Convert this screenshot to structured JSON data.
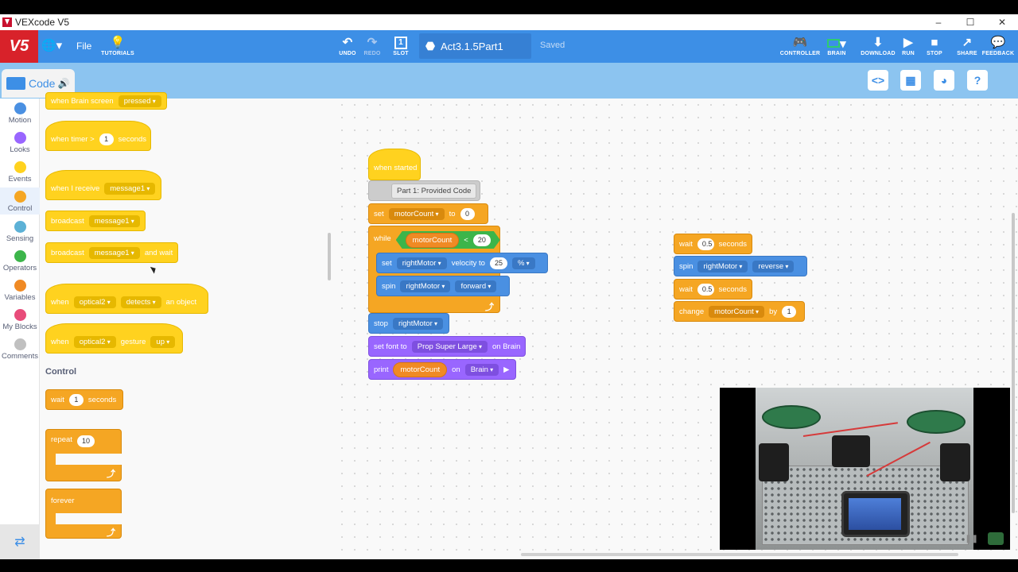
{
  "window": {
    "title": "VEXcode V5",
    "controls": [
      "–",
      "☐",
      "✕"
    ]
  },
  "toolbar": {
    "logo": "V5",
    "file_label": "File",
    "tutorials_label": "TUTORIALS",
    "undo_label": "UNDO",
    "redo_label": "REDO",
    "slot_label": "SLOT",
    "slot_value": "1",
    "project_name": "Act3.1.5Part1",
    "save_status": "Saved",
    "controller_label": "CONTROLLER",
    "brain_label": "BRAIN",
    "download_label": "DOWNLOAD",
    "run_label": "RUN",
    "stop_label": "STOP",
    "share_label": "SHARE",
    "feedback_label": "FEEDBACK"
  },
  "code_tab": {
    "label": "Code"
  },
  "categories": [
    {
      "label": "Motion",
      "color": "#4a90e2"
    },
    {
      "label": "Looks",
      "color": "#9966ff"
    },
    {
      "label": "Events",
      "color": "#ffd21f"
    },
    {
      "label": "Control",
      "color": "#f5a623"
    },
    {
      "label": "Sensing",
      "color": "#5cb1d6"
    },
    {
      "label": "Operators",
      "color": "#3cb54a"
    },
    {
      "label": "Variables",
      "color": "#f08a24"
    },
    {
      "label": "My Blocks",
      "color": "#e84c7a"
    },
    {
      "label": "Comments",
      "color": "#c0c0c0"
    }
  ],
  "palette": {
    "brain_screen": {
      "text": "when Brain screen",
      "opt": "pressed"
    },
    "timer": {
      "text": "when timer >",
      "val": "1",
      "unit": "seconds"
    },
    "receive": {
      "text": "when I receive",
      "opt": "message1"
    },
    "broadcast": {
      "text": "broadcast",
      "opt": "message1"
    },
    "broadcast_wait": {
      "text": "broadcast",
      "opt": "message1",
      "tail": "and wait"
    },
    "optical_detect": {
      "text": "when",
      "opt": "optical2",
      "opt2": "detects",
      "tail": "an object"
    },
    "optical_gesture": {
      "text": "when",
      "opt": "optical2",
      "mid": "gesture",
      "opt2": "up"
    },
    "section_control": "Control",
    "wait": {
      "text": "wait",
      "val": "1",
      "unit": "seconds"
    },
    "repeat": {
      "text": "repeat",
      "val": "10"
    },
    "forever": {
      "text": "forever"
    }
  },
  "script_main": {
    "when_started": "when started",
    "comment": "Part 1: Provided Code",
    "set_var": {
      "text": "set",
      "var": "motorCount",
      "to": "to",
      "val": "0"
    },
    "while": {
      "text": "while",
      "var": "motorCount",
      "op": "<",
      "val": "20"
    },
    "set_velocity": {
      "text": "set",
      "motor": "rightMotor",
      "mid": "velocity to",
      "val": "25",
      "unit": "%"
    },
    "spin": {
      "text": "spin",
      "motor": "rightMotor",
      "dir": "forward"
    },
    "stop": {
      "text": "stop",
      "motor": "rightMotor"
    },
    "set_font": {
      "text": "set font to",
      "font": "Prop Super Large",
      "tail": "on Brain"
    },
    "print": {
      "text": "print",
      "var": "motorCount",
      "mid": "on",
      "target": "Brain"
    }
  },
  "script_side": {
    "wait1": {
      "text": "wait",
      "val": "0.5",
      "unit": "seconds"
    },
    "spin": {
      "text": "spin",
      "motor": "rightMotor",
      "dir": "reverse"
    },
    "wait2": {
      "text": "wait",
      "val": "0.5",
      "unit": "seconds"
    },
    "change": {
      "text": "change",
      "var": "motorCount",
      "by": "by",
      "val": "1"
    }
  }
}
